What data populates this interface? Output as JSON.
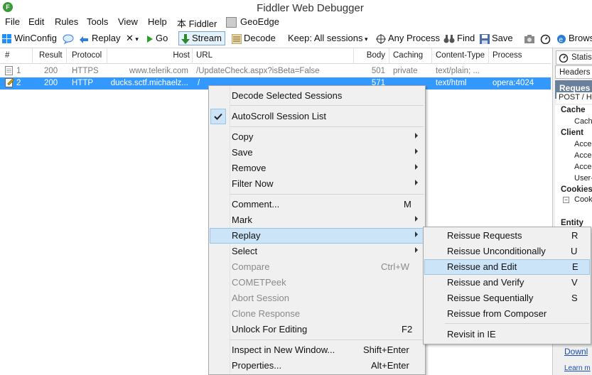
{
  "window": {
    "title": "Fiddler Web Debugger"
  },
  "menubar": [
    "File",
    "Edit",
    "Rules",
    "Tools",
    "View",
    "Help",
    "本 Fiddler",
    "GeoEdge"
  ],
  "toolbar": {
    "winconfig": "WinConfig",
    "replay": "Replay",
    "remove": "✕",
    "go": "Go",
    "stream": "Stream",
    "decode": "Decode",
    "keep": "Keep: All sessions",
    "process": "Any Process",
    "find": "Find",
    "save": "Save",
    "browse": "Brows"
  },
  "grid": {
    "headers": {
      "num": "#",
      "result": "Result",
      "protocol": "Protocol",
      "host": "Host",
      "url": "URL",
      "body": "Body",
      "caching": "Caching",
      "content_type": "Content-Type",
      "process": "Process"
    },
    "rows": [
      {
        "num": "1",
        "result": "200",
        "protocol": "HTTPS",
        "host": "www.telerik.com",
        "url": "/UpdateCheck.aspx?isBeta=False",
        "body": "501",
        "caching": "private",
        "content_type": "text/plain; ...",
        "process": ""
      },
      {
        "num": "2",
        "result": "200",
        "protocol": "HTTP",
        "host": "ducks.sctf.michaelz...",
        "url": "/",
        "body": "571",
        "caching": "",
        "content_type": "text/html",
        "process": "opera:4024"
      }
    ]
  },
  "right_panel": {
    "tab": "Statis",
    "subtab": "Headers",
    "request_line": "POST / H",
    "sections": [
      {
        "title": "Cache",
        "items": [
          "Cache"
        ]
      },
      {
        "title": "Client",
        "items": [
          "Accep",
          "Accep",
          "Accep",
          "User-"
        ]
      },
      {
        "title": "Cookies",
        "items": [
          "Cooki"
        ]
      },
      {
        "title": "Entity",
        "items": []
      }
    ],
    "banner": "Reques",
    "link1": "Downl",
    "link2": "Learn m"
  },
  "context_menu": {
    "items": [
      {
        "label": "Decode Selected Sessions",
        "shortcut": "",
        "submenu": false,
        "disabled": false
      },
      {
        "label": "AutoScroll Session List",
        "shortcut": "",
        "submenu": false,
        "disabled": false,
        "checked": true
      },
      {
        "label": "Copy",
        "shortcut": "",
        "submenu": true,
        "disabled": false
      },
      {
        "label": "Save",
        "shortcut": "",
        "submenu": true,
        "disabled": false
      },
      {
        "label": "Remove",
        "shortcut": "",
        "submenu": true,
        "disabled": false
      },
      {
        "label": "Filter Now",
        "shortcut": "",
        "submenu": true,
        "disabled": false
      },
      {
        "label": "Comment...",
        "shortcut": "M",
        "submenu": false,
        "disabled": false
      },
      {
        "label": "Mark",
        "shortcut": "",
        "submenu": true,
        "disabled": false
      },
      {
        "label": "Replay",
        "shortcut": "",
        "submenu": true,
        "disabled": false,
        "highlighted": true
      },
      {
        "label": "Select",
        "shortcut": "",
        "submenu": true,
        "disabled": false
      },
      {
        "label": "Compare",
        "shortcut": "Ctrl+W",
        "submenu": false,
        "disabled": true
      },
      {
        "label": "COMETPeek",
        "shortcut": "",
        "submenu": false,
        "disabled": true
      },
      {
        "label": "Abort Session",
        "shortcut": "",
        "submenu": false,
        "disabled": true
      },
      {
        "label": "Clone Response",
        "shortcut": "",
        "submenu": false,
        "disabled": true
      },
      {
        "label": "Unlock For Editing",
        "shortcut": "F2",
        "submenu": false,
        "disabled": false
      },
      {
        "label": "Inspect in New Window...",
        "shortcut": "Shift+Enter",
        "submenu": false,
        "disabled": false
      },
      {
        "label": "Properties...",
        "shortcut": "Alt+Enter",
        "submenu": false,
        "disabled": false
      }
    ]
  },
  "replay_submenu": {
    "items": [
      {
        "label": "Reissue Requests",
        "shortcut": "R"
      },
      {
        "label": "Reissue Unconditionally",
        "shortcut": "U"
      },
      {
        "label": "Reissue and Edit",
        "shortcut": "E",
        "highlighted": true
      },
      {
        "label": "Reissue and Verify",
        "shortcut": "V"
      },
      {
        "label": "Reissue Sequentially",
        "shortcut": "S"
      },
      {
        "label": "Reissue from Composer",
        "shortcut": ""
      },
      {
        "label": "Revisit in IE",
        "shortcut": ""
      }
    ]
  },
  "colors": {
    "selection": "#3399ff",
    "menu_highlight": "#cce4f7",
    "link": "#1a4fb5"
  }
}
